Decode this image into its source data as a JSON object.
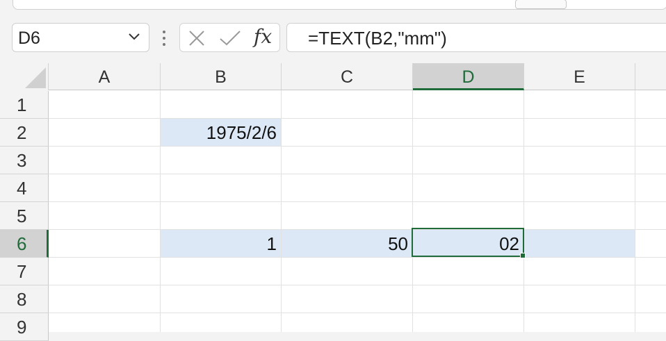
{
  "name_box": {
    "value": "D6"
  },
  "formula_bar": {
    "fx_label": "fx",
    "formula": "=TEXT(B2,\"mm\")"
  },
  "columns": [
    "A",
    "B",
    "C",
    "D",
    "E"
  ],
  "rows": [
    "1",
    "2",
    "3",
    "4",
    "5",
    "6",
    "7",
    "8",
    "9"
  ],
  "active_cell": {
    "ref": "D6",
    "column": "D",
    "row": "6"
  },
  "cells": {
    "B2": "1975/2/6",
    "B6": "1",
    "C6": "50",
    "D6": "02"
  },
  "colors": {
    "accent": "#1f6b3a",
    "highlight": "#dde8f6",
    "gridline": "#e1e1e1",
    "header_bg": "#f3f3f3"
  },
  "icons": {
    "chevron": "chevron-down-icon",
    "cancel": "x-icon",
    "enter": "checkmark-icon",
    "function": "fx-icon",
    "options": "vertical-dots-icon"
  }
}
